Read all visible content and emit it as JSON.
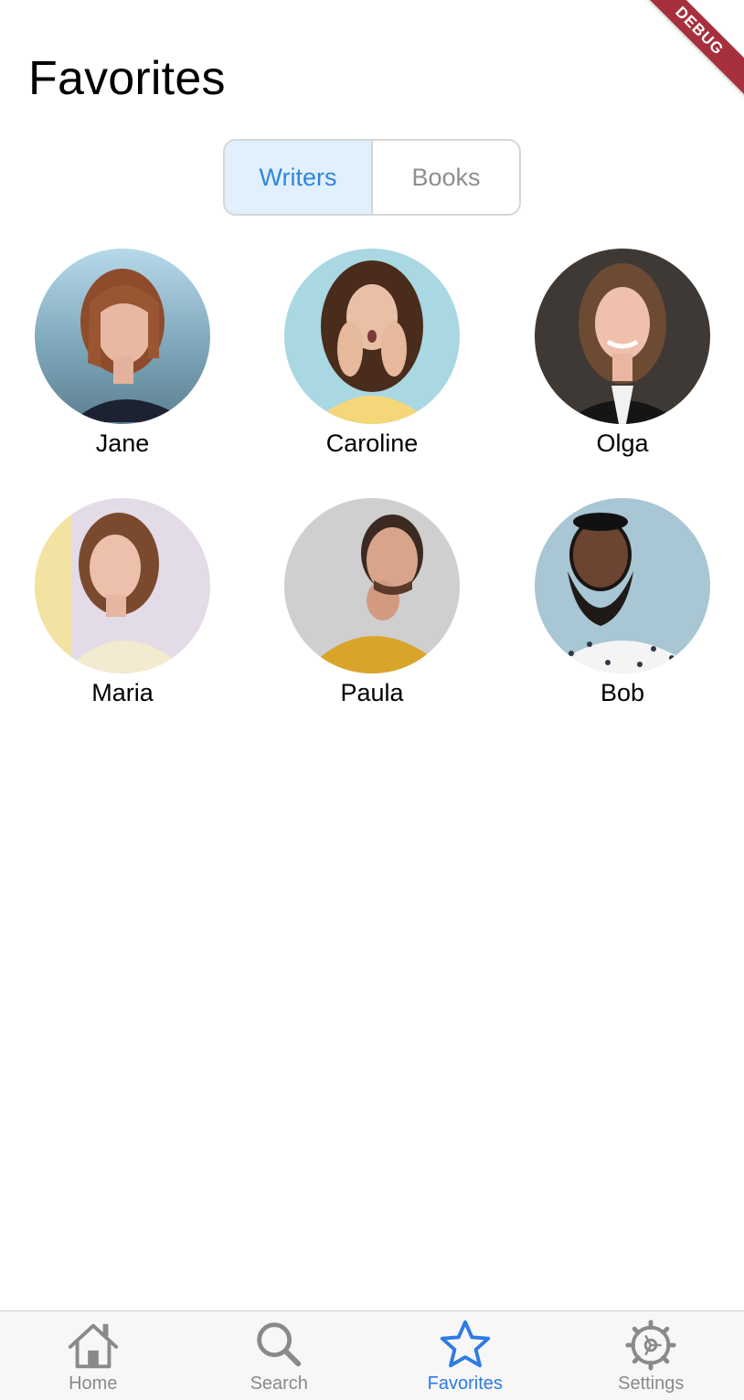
{
  "debug_banner": "DEBUG",
  "page": {
    "title": "Favorites"
  },
  "segments": [
    {
      "label": "Writers",
      "active": true
    },
    {
      "label": "Books",
      "active": false
    }
  ],
  "writers": [
    {
      "name": "Jane"
    },
    {
      "name": "Caroline"
    },
    {
      "name": "Olga"
    },
    {
      "name": "Maria"
    },
    {
      "name": "Paula"
    },
    {
      "name": "Bob"
    }
  ],
  "tabbar": {
    "tabs": [
      {
        "label": "Home",
        "icon": "home-icon",
        "active": false
      },
      {
        "label": "Search",
        "icon": "search-icon",
        "active": false
      },
      {
        "label": "Favorites",
        "icon": "star-icon",
        "active": true
      },
      {
        "label": "Settings",
        "icon": "gear-icon",
        "active": false
      }
    ]
  },
  "colors": {
    "accent": "#2f7ae5",
    "segment_active_bg": "#e1f0fc",
    "segment_active_text": "#2f86de",
    "inactive": "#8a8a8a",
    "debug_ribbon": "#a6303d"
  }
}
